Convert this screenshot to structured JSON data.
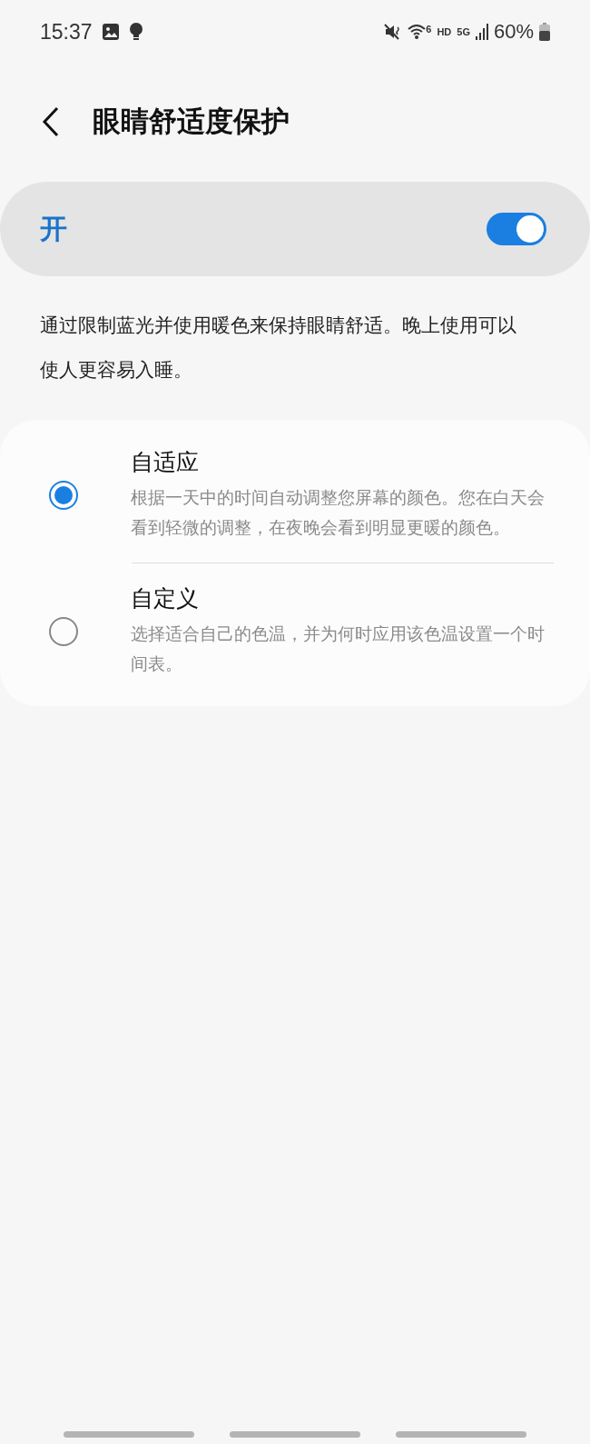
{
  "status_bar": {
    "time": "15:37",
    "wifi_label": "6",
    "network_labels": [
      "HD",
      "5G"
    ],
    "battery": "60%"
  },
  "header": {
    "title": "眼睛舒适度保护"
  },
  "master_switch": {
    "label": "开",
    "on": true
  },
  "description": "通过限制蓝光并使用暖色来保持眼睛舒适。晚上使用可以使人更容易入睡。",
  "options": [
    {
      "title": "自适应",
      "subtitle": "根据一天中的时间自动调整您屏幕的颜色。您在白天会看到轻微的调整，在夜晚会看到明显更暖的颜色。",
      "selected": true
    },
    {
      "title": "自定义",
      "subtitle": "选择适合自己的色温，并为何时应用该色温设置一个时间表。",
      "selected": false
    }
  ]
}
